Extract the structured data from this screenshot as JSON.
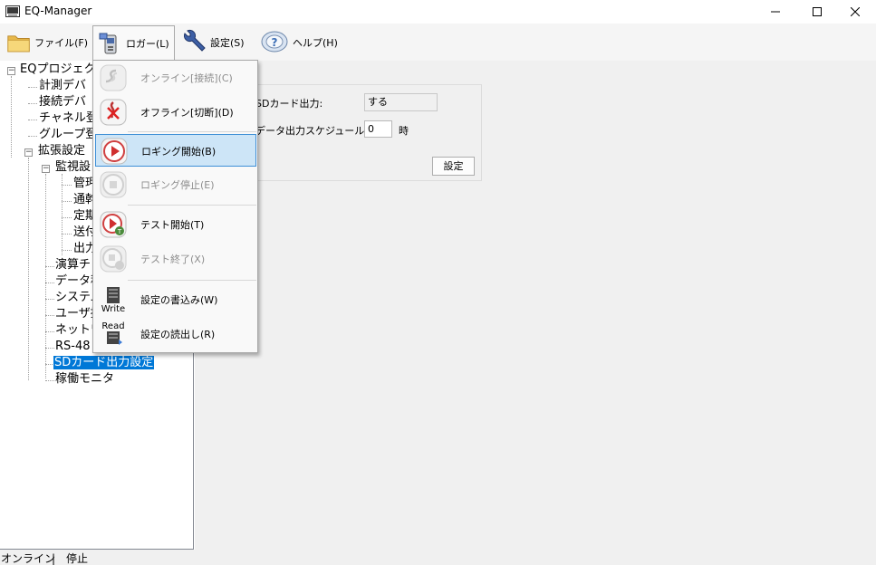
{
  "window": {
    "title": "EQ-Manager"
  },
  "menu": {
    "file": "ファイル(F)",
    "logger": "ロガー(L)",
    "settings": "設定(S)",
    "help": "ヘルプ(H)"
  },
  "tree": {
    "root": "EQプロジェクト",
    "items": [
      "計測デバ",
      "接続デバ",
      "チャネル登",
      "グループ登"
    ],
    "ext": "拡張設定",
    "monitor": "監視設",
    "monitor_children": [
      "管玾",
      "通幹",
      "定期",
      "送付",
      "出力"
    ],
    "ext_children": [
      "演算チ",
      "データ種",
      "システム",
      "ユーザ挑",
      "ネットワ",
      "RS-48"
    ],
    "sd_output": "SDカード出力設定",
    "monitor_status": "稼働モニタ"
  },
  "form": {
    "sd_label": "SDカード出力:",
    "sd_value": "する",
    "schedule_label": "データ出力スケジュール:",
    "schedule_value": "0",
    "schedule_unit": "時",
    "set_button": "設定"
  },
  "dropdown": {
    "online": "オンライン[接続](C)",
    "offline": "オフライン[切断](D)",
    "logging_start": "ロギング開始(B)",
    "logging_stop": "ロギング停止(E)",
    "test_start": "テスト開始(T)",
    "test_end": "テスト終了(X)",
    "write_settings": "設定の書込み(W)",
    "read_settings": "設定の読出し(R)",
    "write_icon_text": "Write",
    "read_icon_text": "Read"
  },
  "status": {
    "connection": "オンライン",
    "separator": "|",
    "state": "停止"
  },
  "colors": {
    "selection": "#0078d7",
    "menu_highlight": "#cde5f7",
    "content_bg": "#f0f0f0"
  },
  "icons": [
    "app-icon",
    "folder-icon",
    "logger-icon",
    "wrench-icon",
    "help-icon",
    "online-icon",
    "offline-icon",
    "play-icon",
    "stop-icon",
    "test-start-icon",
    "test-end-icon",
    "write-icon",
    "read-icon"
  ]
}
